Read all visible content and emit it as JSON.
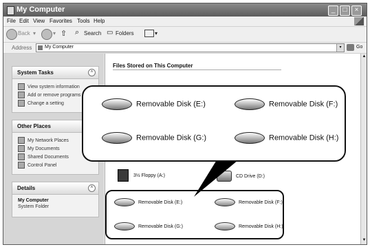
{
  "window": {
    "title": "My Computer"
  },
  "menu": [
    "File",
    "Edit",
    "View",
    "Favorites",
    "Tools",
    "Help"
  ],
  "toolbar": {
    "back": "Back",
    "search": "Search",
    "folders": "Folders"
  },
  "address": {
    "label": "Address",
    "value": "My Computer",
    "go": "Go"
  },
  "system_tasks": {
    "title": "System Tasks",
    "items": [
      "View system information",
      "Add or remove programs",
      "Change a setting"
    ]
  },
  "other_places": {
    "title": "Other Places",
    "items": [
      "My Network Places",
      "My Documents",
      "Shared Documents",
      "Control Panel"
    ]
  },
  "details": {
    "title": "Details",
    "name": "My Computer",
    "type": "System Folder"
  },
  "content": {
    "section_title": "Files Stored on This Computer",
    "floppy": "3½ Floppy (A:)",
    "cd": "CD Drive (D:)",
    "removable": [
      "Removable Disk (E:)",
      "Removable Disk (F:)",
      "Removable Disk (G:)",
      "Removable Disk (H:)"
    ]
  },
  "callout": {
    "drives": [
      "Removable Disk (E:)",
      "Removable Disk (F:)",
      "Removable Disk (G:)",
      "Removable Disk (H:)"
    ]
  }
}
